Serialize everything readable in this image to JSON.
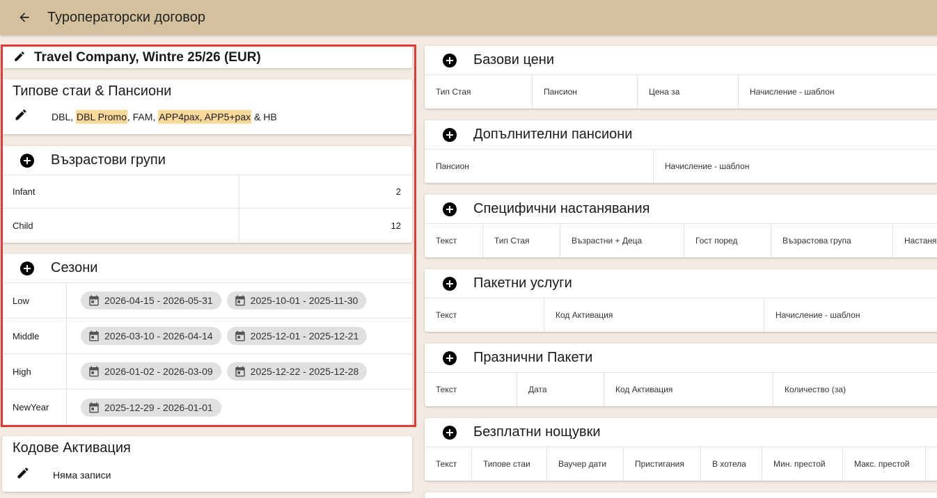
{
  "header": {
    "title": "Туроператорски договор",
    "back_icon": "arrow-back-icon",
    "bg": "#d2c19c"
  },
  "contract": {
    "title": "Travel Company, Wintre 25/26 (EUR)"
  },
  "room_types": {
    "title": "Типове стаи & Пансиони",
    "parts": [
      {
        "text": "DBL",
        "highlight": false
      },
      {
        "text": ", ",
        "highlight": false
      },
      {
        "text": "DBL Promo",
        "highlight": true
      },
      {
        "text": ", FAM, ",
        "highlight": false
      },
      {
        "text": "APP4pax, APP5+pax",
        "highlight": true
      },
      {
        "text": " & HB",
        "highlight": false
      }
    ]
  },
  "age_groups": {
    "title": "Възрастови групи",
    "rows": [
      {
        "name": "Infant",
        "value": "2"
      },
      {
        "name": "Child",
        "value": "12"
      }
    ]
  },
  "seasons": {
    "title": "Сезони",
    "rows": [
      {
        "name": "Low",
        "ranges": [
          "2026-04-15 - 2026-05-31",
          "2025-10-01 - 2025-11-30"
        ]
      },
      {
        "name": "Middle",
        "ranges": [
          "2026-03-10 - 2026-04-14",
          "2025-12-01 - 2025-12-21"
        ]
      },
      {
        "name": "High",
        "ranges": [
          "2026-01-02 - 2026-03-09",
          "2025-12-22 - 2025-12-28"
        ]
      },
      {
        "name": "NewYear",
        "ranges": [
          "2025-12-29 - 2026-01-01"
        ]
      }
    ]
  },
  "activation_codes": {
    "title": "Кодове Активация",
    "empty": "Няма записи"
  },
  "right_sections": [
    {
      "title": "Базови цени",
      "columns": [
        "Тип Стая",
        "Пансион",
        "Цена за",
        "Начисление - шаблон"
      ]
    },
    {
      "title": "Допълнителни пансиони",
      "columns": [
        "Пансион",
        "Начисление - шаблон"
      ]
    },
    {
      "title": "Специфични настанявания",
      "columns": [
        "Текст",
        "Тип Стая",
        "Възрастни + Деца",
        "Гост поред",
        "Възрастова група",
        "Настаня"
      ]
    },
    {
      "title": "Пакетни услуги",
      "columns": [
        "Текст",
        "Код Активация",
        "Начисление - шаблон"
      ]
    },
    {
      "title": "Празнични Пакети",
      "columns": [
        "Текст",
        "Дата",
        "Код Активация",
        "Количество (за)"
      ]
    },
    {
      "title": "Безплатни нощувки",
      "columns": [
        "Текст",
        "Типове стаи",
        "Ваучер дати",
        "Пристигания",
        "В хотела",
        "Мин. престой",
        "Макс. престой",
        ""
      ]
    }
  ],
  "colors": {
    "highlight": "#fcd89a",
    "frame": "#e53935",
    "background": "#f3ebe2"
  }
}
